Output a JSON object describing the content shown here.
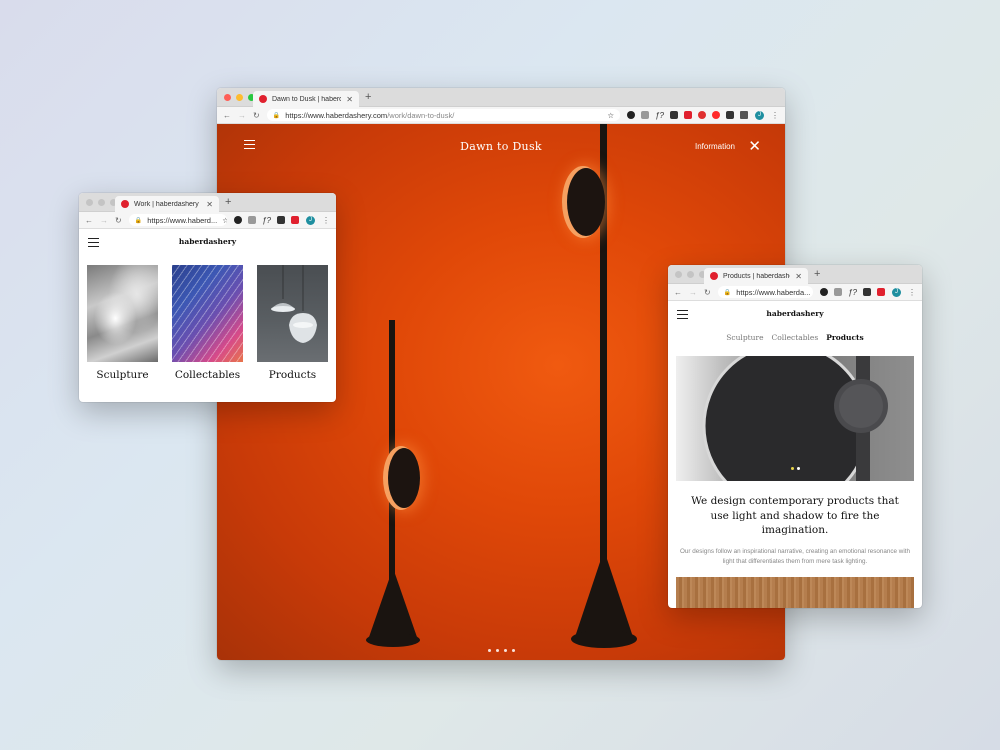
{
  "main_window": {
    "tab_title": "Dawn to Dusk | haberdashery",
    "url_host": "https://www.haberdashery.com",
    "url_path": "/work/dawn-to-dusk/",
    "hero": {
      "title": "Dawn to Dusk",
      "info_link": "Information",
      "close_icon": "close-icon",
      "slides": 4
    }
  },
  "work_window": {
    "tab_title": "Work | haberdashery",
    "url": "https://www.haberd...",
    "site_name": "haberdashery",
    "cards": [
      {
        "label": "Sculpture"
      },
      {
        "label": "Collectables"
      },
      {
        "label": "Products"
      }
    ]
  },
  "products_window": {
    "tab_title": "Products | haberdashery",
    "url": "https://www.haberda...",
    "site_name": "haberdashery",
    "subnav": [
      "Sculpture",
      "Collectables",
      "Products"
    ],
    "active_subnav": "Products",
    "heading": "We design contemporary products that use light and shadow to fire the imagination.",
    "body": "Our designs follow an inspirational narrative, creating an emotional resonance with light that differentiates them from mere task lighting."
  },
  "colors": {
    "favicon": "#e0202e",
    "hero_orange": "#e04808",
    "traffic_red": "#ff5f57",
    "traffic_yellow": "#febc2e",
    "traffic_green": "#28c840",
    "avatar": "#1f8fa0",
    "slide_dot_active": "#e8d44a"
  },
  "icons": [
    "menu-icon",
    "back-icon",
    "forward-icon",
    "reload-icon",
    "lock-icon",
    "star-icon",
    "close-icon",
    "plus-icon",
    "more-icon"
  ]
}
